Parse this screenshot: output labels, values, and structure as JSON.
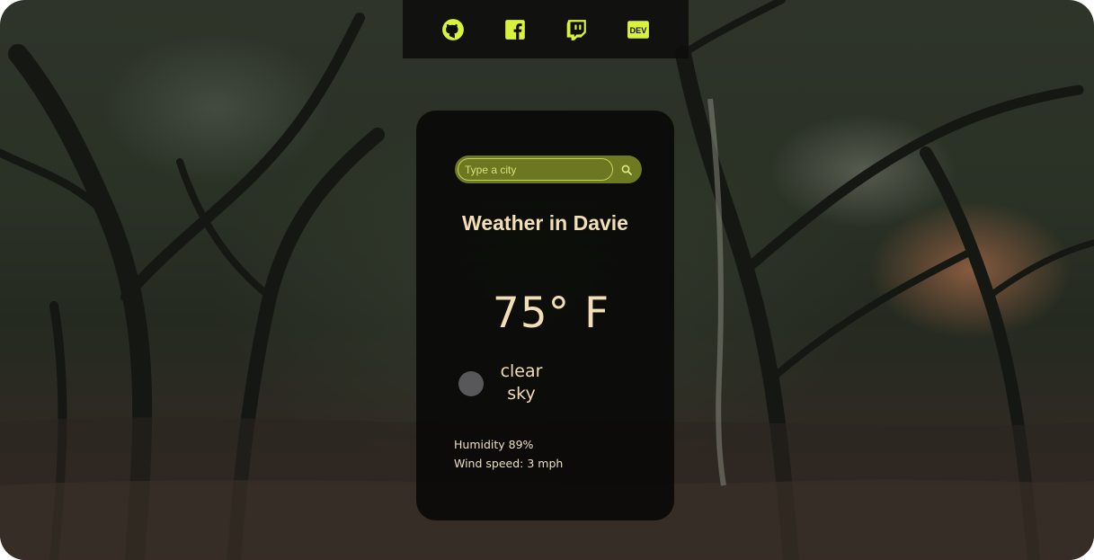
{
  "social": [
    {
      "name": "github",
      "icon": "github-icon",
      "color": "#d9f23c"
    },
    {
      "name": "facebook",
      "icon": "facebook-icon",
      "color": "#d9f23c"
    },
    {
      "name": "twitch",
      "icon": "twitch-icon",
      "color": "#d9f23c"
    },
    {
      "name": "dev",
      "icon": "dev-icon",
      "label": "DEV",
      "color": "#d9f23c"
    }
  ],
  "search": {
    "placeholder": "Type a city",
    "button_icon": "search-icon"
  },
  "weather": {
    "title": "Weather in Davie",
    "temperature": "75° F",
    "description": "clear sky",
    "humidity": "Humidity 89%",
    "wind": "Wind speed: 3 mph"
  },
  "colors": {
    "accent": "#d9f23c",
    "text": "#f2dfb6",
    "search_bg": "#6d7a22"
  }
}
